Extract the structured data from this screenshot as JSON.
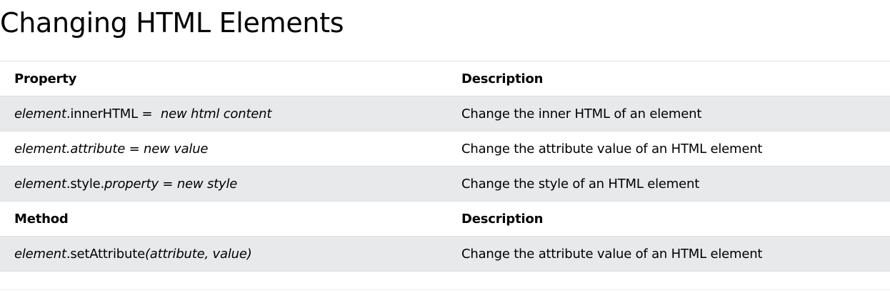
{
  "page": {
    "title": "Changing HTML Elements"
  },
  "table": {
    "property_header": {
      "col1": "Property",
      "col2": "Description"
    },
    "property_rows": [
      {
        "object": "element",
        "member": ".innerHTML =",
        "value": "new html content",
        "description": "Change the inner HTML of an element"
      },
      {
        "object": "element",
        "member": ".attribute = new value",
        "description": "Change the attribute value of an HTML element"
      },
      {
        "object": "element",
        "member_plain": ".style.",
        "member_italic": "property",
        "rest": " = ",
        "value": "new style",
        "description": "Change the style of an HTML element"
      }
    ],
    "method_header": {
      "col1": "Method",
      "col2": "Description"
    },
    "method_rows": [
      {
        "object": "element",
        "method": ".setAttribute",
        "args": "(attribute, value)",
        "description": "Change the attribute value of an HTML element"
      }
    ]
  },
  "colors": {
    "row_shade": "#e7e9eb",
    "border": "#dddddd",
    "text": "#000000"
  }
}
